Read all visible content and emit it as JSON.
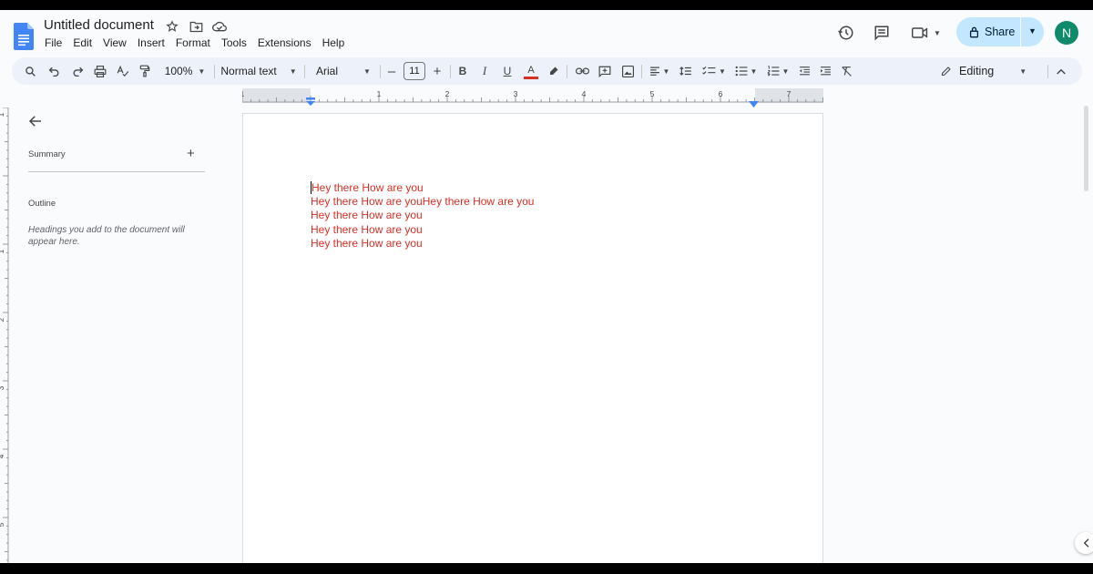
{
  "header": {
    "title": "Untitled document",
    "menu": [
      "File",
      "Edit",
      "View",
      "Insert",
      "Format",
      "Tools",
      "Extensions",
      "Help"
    ],
    "share_label": "Share",
    "avatar_letter": "N"
  },
  "toolbar": {
    "zoom": "100%",
    "style": "Normal text",
    "font": "Arial",
    "font_size": "11",
    "mode": "Editing"
  },
  "ruler": {
    "labels": [
      "1",
      "1",
      "2",
      "3",
      "4",
      "5",
      "6",
      "7"
    ],
    "vlabels": [
      "1",
      "1",
      "2",
      "3",
      "4",
      "5"
    ]
  },
  "sidebar": {
    "summary_label": "Summary",
    "outline_label": "Outline",
    "outline_hint": "Headings you add to the document will appear here."
  },
  "document": {
    "lines": [
      "Hey there How are you",
      "Hey there How are youHey there How are you",
      "Hey there How are you",
      "Hey there How are you",
      "Hey there How are you"
    ],
    "text_color": "#d93025"
  },
  "colors": {
    "accent": "#0b57d0",
    "share_bg": "#c2e7ff",
    "avatar_bg": "#0f8a6a",
    "toolbar_bg": "#edf2fa"
  }
}
